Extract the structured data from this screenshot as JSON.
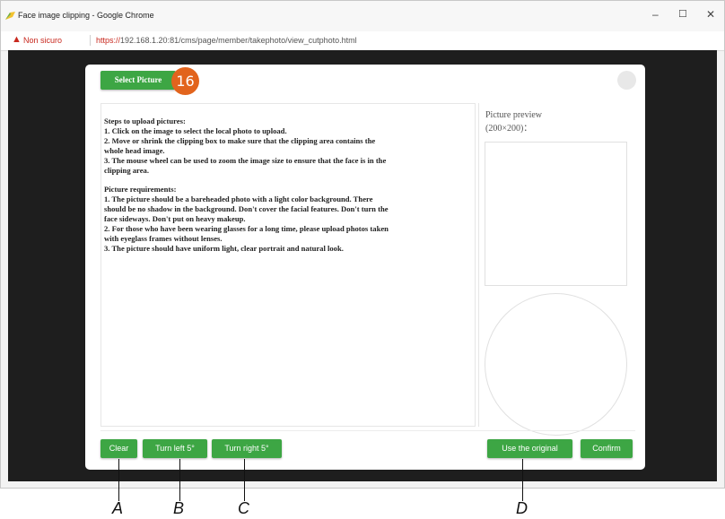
{
  "browser": {
    "window_title": "Face image clipping - Google Chrome",
    "security_label": "Non sicuro",
    "url_protocol": "https://",
    "url_rest": "192.168.1.20:81/cms/page/member/takephoto/view_cutphoto.html",
    "controls": {
      "minimize": "–",
      "maximize": "☐",
      "close": "✕"
    }
  },
  "dialog": {
    "select_button": "Select Picture",
    "badge": "16",
    "instructions": {
      "steps_lines": [
        "Steps to upload pictures:",
        "1. Click on the image to select the local photo to upload.",
        "2. Move or shrink the clipping box to make sure that the clipping area contains the",
        "whole head image.",
        "3. The mouse wheel can be used to zoom the image size to ensure that the face is in the",
        "clipping area."
      ],
      "req_lines": [
        "Picture requirements:",
        "1. The picture should be a bareheaded photo with a light color background. There",
        "should be no shadow in the background. Don't cover the facial features. Don't turn the",
        "face sideways. Don't put on heavy makeup.",
        "2. For those who have been wearing glasses for a long time, please upload photos taken",
        "with eyeglass frames without lenses.",
        "3. The picture should have uniform light, clear portrait and natural look."
      ]
    },
    "preview_label_1": "Picture preview",
    "preview_label_2": "(200×200)：",
    "buttons": {
      "clear": "Clear",
      "turn_left": "Turn left 5°",
      "turn_right": "Turn right 5°",
      "use_original": "Use the original",
      "confirm": "Confirm"
    }
  },
  "annotations": {
    "a": "A",
    "b": "B",
    "c": "C",
    "d": "D"
  },
  "colors": {
    "accent_green": "#3da644",
    "badge_orange": "#e2641d",
    "warning_red": "#c8281e"
  }
}
